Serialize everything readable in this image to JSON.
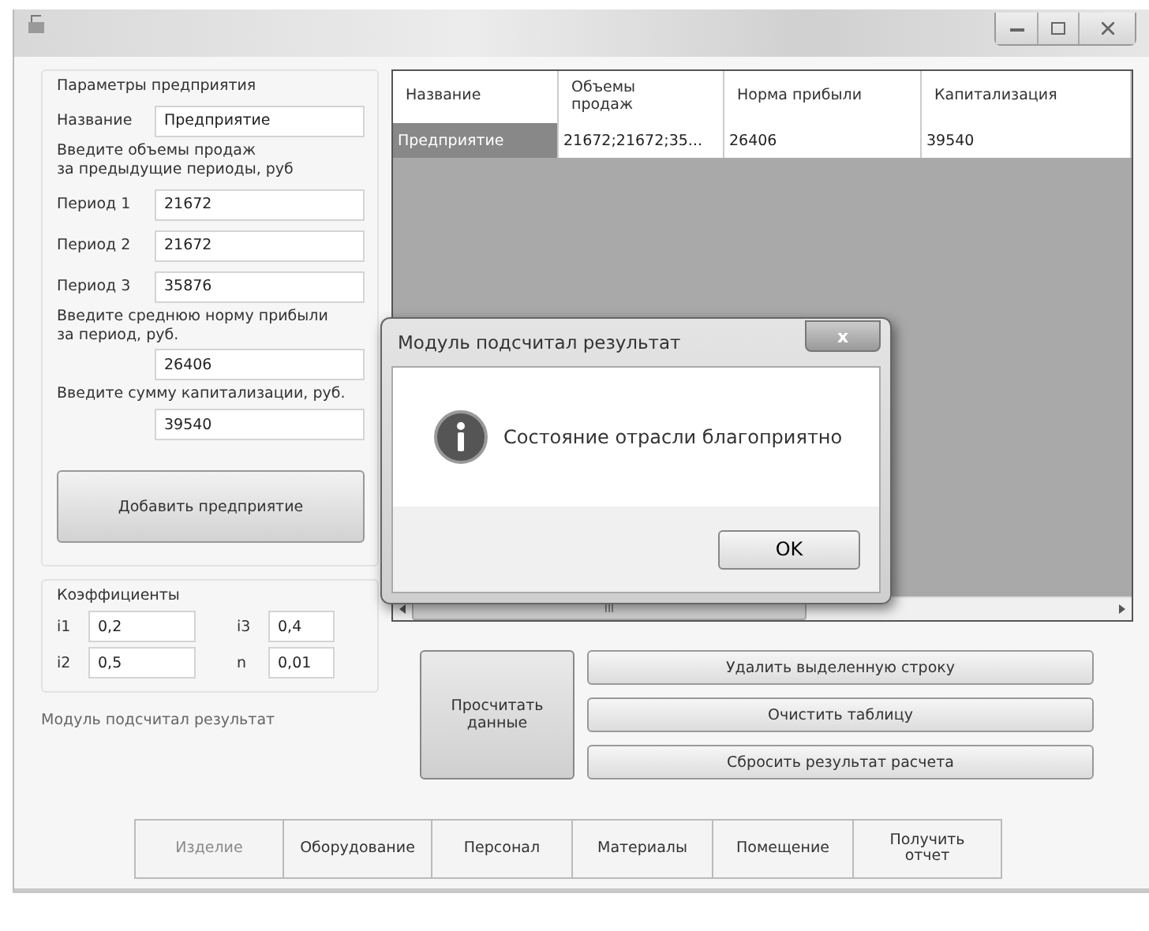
{
  "window": {
    "controls": [
      {
        "kind": "minimize"
      },
      {
        "kind": "maximize"
      },
      {
        "kind": "close"
      }
    ]
  },
  "params": {
    "title": "Параметры предприятия",
    "name_label": "Название",
    "name_value": "Предприятие",
    "sales_hint": "Введите объемы продаж\nза предыдущие периоды, руб",
    "periods": [
      {
        "label": "Период 1",
        "value": "21672"
      },
      {
        "label": "Период 2",
        "value": "21672"
      },
      {
        "label": "Период 3",
        "value": "35876"
      }
    ],
    "profit_hint": "Введите среднюю норму прибыли\nза период, руб.",
    "profit_value": "26406",
    "cap_hint": "Введите сумму капитализации, руб.",
    "cap_value": "39540",
    "add_button": "Добавить предприятие"
  },
  "coefficients": {
    "title": "Коэффициенты",
    "items": [
      {
        "label": "i1",
        "value": "0,2"
      },
      {
        "label": "i3",
        "value": "0,4"
      },
      {
        "label": "i2",
        "value": "0,5"
      },
      {
        "label": "n",
        "value": "0,01"
      }
    ]
  },
  "status": "Модуль подсчитал результат",
  "table": {
    "columns": [
      "Название",
      "Объемы\nпродаж",
      "Норма прибыли",
      "Капитализация"
    ],
    "rows": [
      [
        {
          "text": "Предприятие",
          "selected": true
        },
        {
          "text": "21672;21672;35...",
          "selected": false
        },
        {
          "text": "26406",
          "selected": false
        },
        {
          "text": "39540",
          "selected": false
        }
      ]
    ],
    "scroll_thumb": "III"
  },
  "calc_button": "Просчитать\nданные",
  "actions": [
    "Удалить выделенную строку",
    "Очистить таблицу",
    "Сбросить результат расчета"
  ],
  "nav": [
    {
      "label": "Изделие",
      "disabled": true
    },
    {
      "label": "Оборудование",
      "disabled": false
    },
    {
      "label": "Персонал",
      "disabled": false
    },
    {
      "label": "Материалы",
      "disabled": false
    },
    {
      "label": "Помещение",
      "disabled": false
    },
    {
      "label": "Получить\nотчет",
      "disabled": false
    }
  ],
  "dialog": {
    "title": "Модуль подсчитал результат",
    "close": "x",
    "message": "Состояние отрасли благоприятно",
    "ok": "OK"
  }
}
